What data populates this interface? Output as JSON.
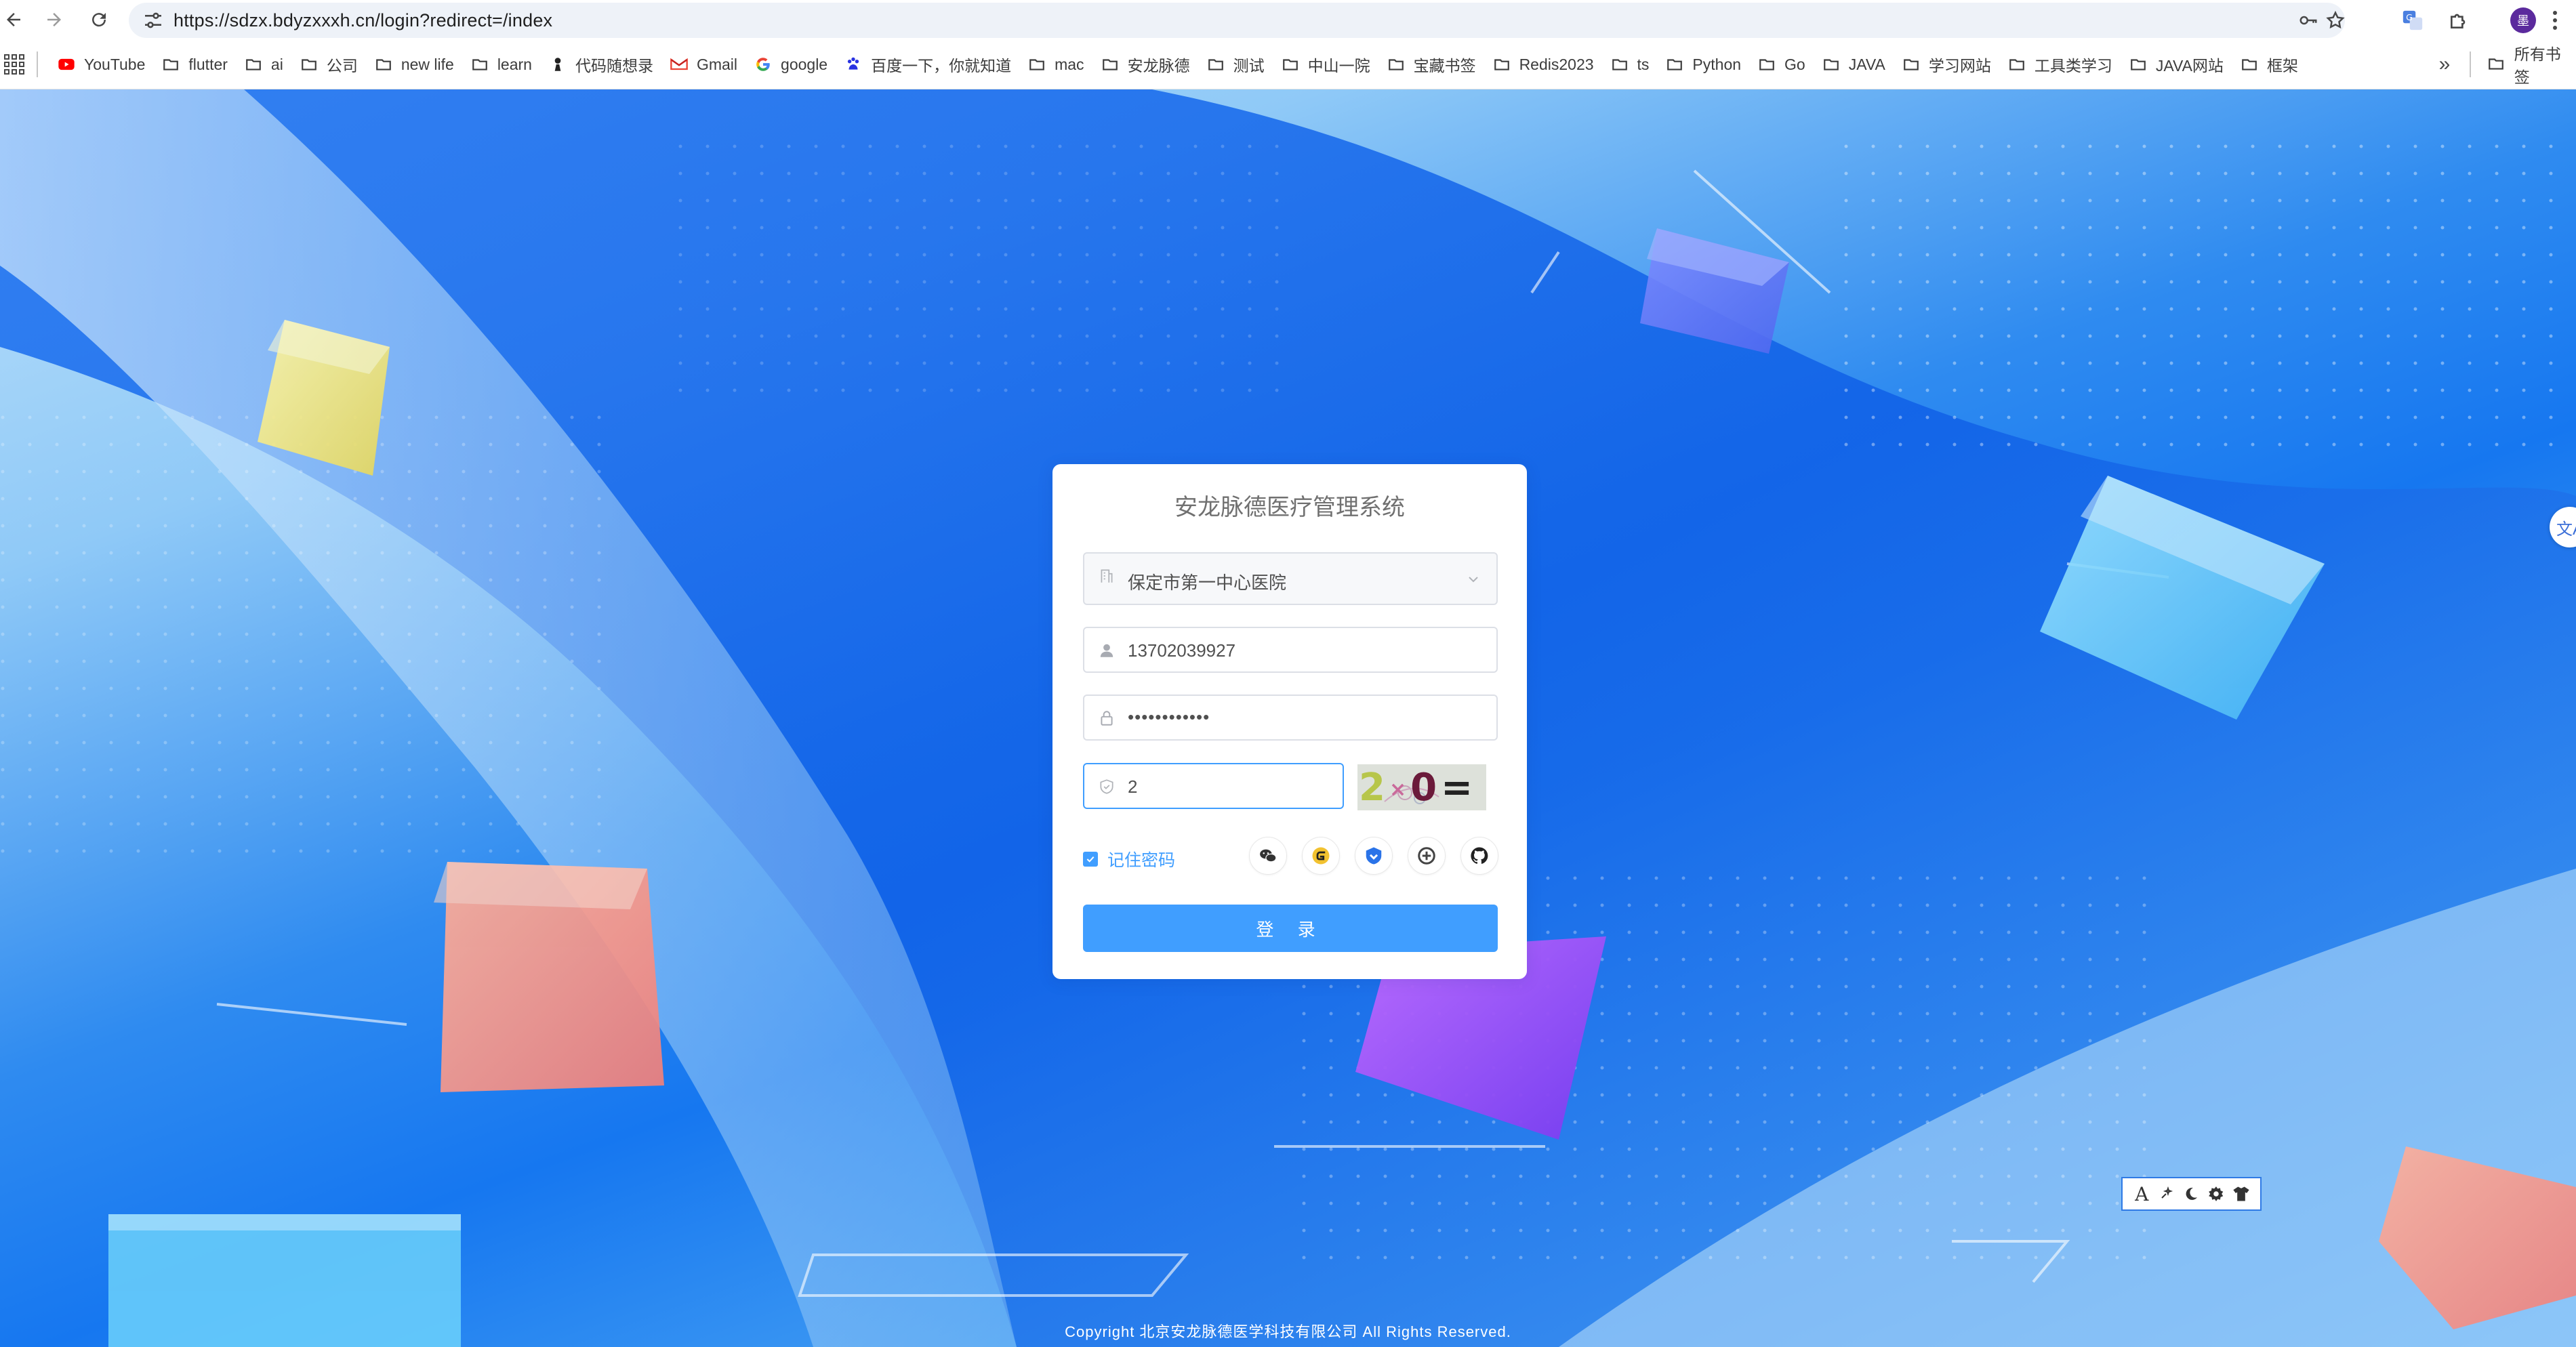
{
  "browser": {
    "url": "https://sdzx.bdyzxxxh.cn/login?redirect=/index",
    "avatar_letter": "墨",
    "bookmarks": [
      {
        "label": "YouTube",
        "icon": "youtube-icon"
      },
      {
        "label": "flutter",
        "icon": "folder-icon"
      },
      {
        "label": "ai",
        "icon": "folder-icon"
      },
      {
        "label": "公司",
        "icon": "folder-icon"
      },
      {
        "label": "new life",
        "icon": "folder-icon"
      },
      {
        "label": "learn",
        "icon": "folder-icon"
      },
      {
        "label": "代码随想录",
        "icon": "site-icon"
      },
      {
        "label": "Gmail",
        "icon": "gmail-icon"
      },
      {
        "label": "google",
        "icon": "google-icon"
      },
      {
        "label": "百度一下，你就知道",
        "icon": "baidu-icon"
      },
      {
        "label": "mac",
        "icon": "folder-icon"
      },
      {
        "label": "安龙脉德",
        "icon": "folder-icon"
      },
      {
        "label": "测试",
        "icon": "folder-icon"
      },
      {
        "label": "中山一院",
        "icon": "folder-icon"
      },
      {
        "label": "宝藏书签",
        "icon": "folder-icon"
      },
      {
        "label": "Redis2023",
        "icon": "folder-icon"
      },
      {
        "label": "ts",
        "icon": "folder-icon"
      },
      {
        "label": "Python",
        "icon": "folder-icon"
      },
      {
        "label": "Go",
        "icon": "folder-icon"
      },
      {
        "label": "JAVA",
        "icon": "folder-icon"
      },
      {
        "label": "学习网站",
        "icon": "folder-icon"
      },
      {
        "label": "工具类学习",
        "icon": "folder-icon"
      },
      {
        "label": "JAVA网站",
        "icon": "folder-icon"
      },
      {
        "label": "框架",
        "icon": "folder-icon"
      }
    ],
    "all_bookmarks_label": "所有书签",
    "more_bookmarks": "»"
  },
  "login": {
    "title": "安龙脉德医疗管理系统",
    "hospital_value": "保定市第一中心医院",
    "username_value": "13702039927",
    "password_value": "••••••••••••",
    "captcha_input_value": "2",
    "captcha_image_text": "2×0=",
    "remember_label": "记住密码",
    "remember_checked": true,
    "login_button": "登 录",
    "social_icons": [
      "wechat-icon",
      "gitee-icon",
      "maxkey-icon",
      "topiam-icon",
      "github-icon"
    ]
  },
  "float_toolbar": {
    "items": [
      "font-icon",
      "sparkle-icon",
      "moon-icon",
      "gear-icon",
      "shirt-icon"
    ],
    "font_glyph": "A"
  },
  "side_translate": "文A",
  "footer": "Copyright 北京安龙脉德医学科技有限公司 All Rights Reserved.",
  "colors": {
    "primary": "#409eff",
    "page_blue": "#1677f0"
  }
}
